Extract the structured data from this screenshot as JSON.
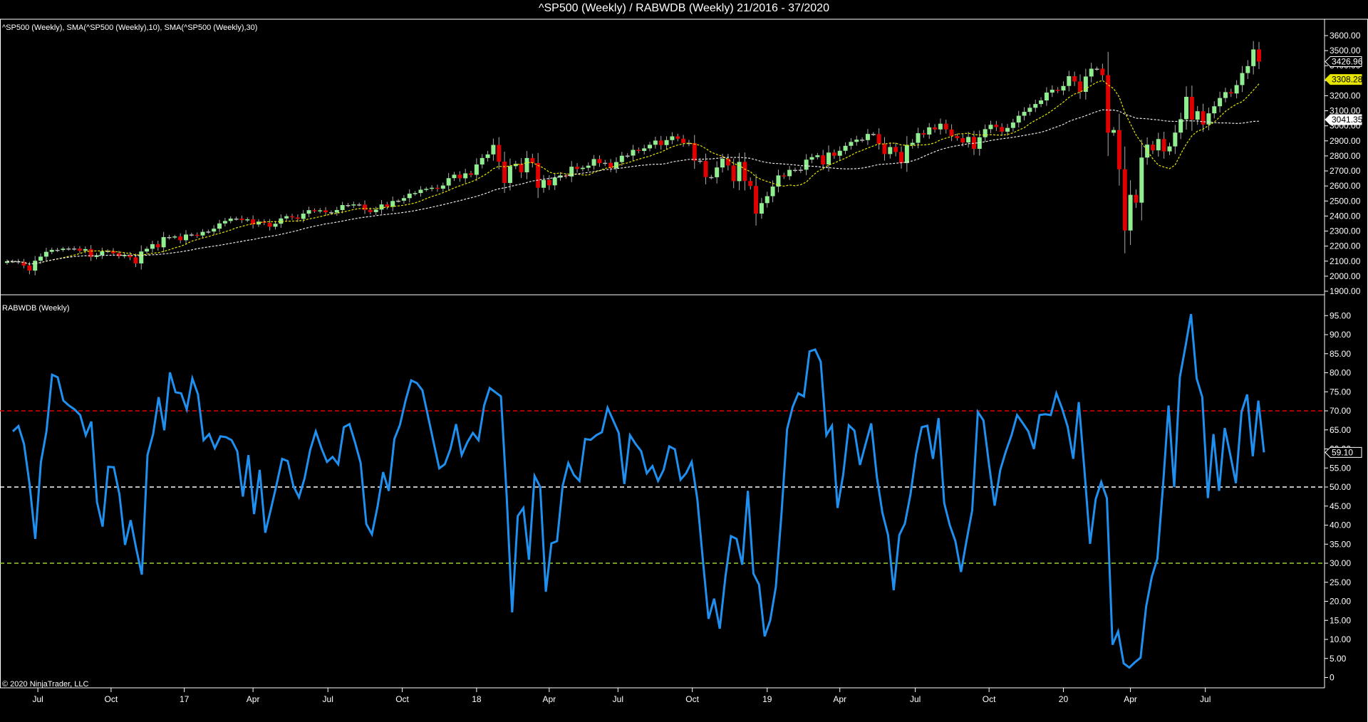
{
  "header": {
    "title": "^SP500 (Weekly) / RABWDB (Weekly)  21/2016 - 37/2020"
  },
  "price_panel": {
    "legend": "^SP500 (Weekly), SMA(^SP500 (Weekly),10), SMA(^SP500 (Weekly),30)"
  },
  "indicator_panel": {
    "legend": "RABWDB (Weekly)"
  },
  "footer": {
    "copyright": "© 2020 NinjaTrader, LLC"
  },
  "colors": {
    "up": "#90ee90",
    "down": "#e00000",
    "sma10": "#e6e600",
    "sma30": "#e8e8e8",
    "indicator": "#2090f0",
    "overbought": "#e00000",
    "mid": "#ffffff",
    "oversold": "#9acd32"
  },
  "chart_data": [
    {
      "type": "candlestick",
      "title": "^SP500 (Weekly)",
      "ylim": [
        1900,
        3600
      ],
      "yticks": [
        "1900.00",
        "2000.00",
        "2100.00",
        "2200.00",
        "2300.00",
        "2400.00",
        "2500.00",
        "2600.00",
        "2700.00",
        "2800.00",
        "2900.00",
        "3000.00",
        "3100.00",
        "3200.00",
        "3300.00",
        "3400.00",
        "3500.00",
        "3600.00"
      ],
      "yticks_values": [
        1900,
        2000,
        2100,
        2200,
        2300,
        2400,
        2500,
        2600,
        2700,
        2800,
        2900,
        3000,
        3100,
        3200,
        3300,
        3400,
        3500,
        3600
      ],
      "closes": [
        2099,
        2099,
        2096,
        2071,
        2037,
        2103,
        2130,
        2162,
        2175,
        2174,
        2183,
        2184,
        2184,
        2169,
        2180,
        2128,
        2139,
        2165,
        2168,
        2153,
        2133,
        2141,
        2126,
        2085,
        2164,
        2182,
        2213,
        2192,
        2260,
        2258,
        2264,
        2239,
        2277,
        2275,
        2271,
        2295,
        2297,
        2316,
        2351,
        2367,
        2383,
        2383,
        2373,
        2378,
        2344,
        2363,
        2355,
        2329,
        2349,
        2384,
        2399,
        2391,
        2381,
        2416,
        2439,
        2433,
        2438,
        2425,
        2423,
        2440,
        2473,
        2472,
        2477,
        2476,
        2441,
        2426,
        2443,
        2477,
        2461,
        2500,
        2502,
        2519,
        2549,
        2553,
        2575,
        2581,
        2588,
        2582,
        2603,
        2652,
        2675,
        2651,
        2684,
        2674,
        2743,
        2786,
        2810,
        2873,
        2762,
        2620,
        2732,
        2747,
        2691,
        2786,
        2752,
        2588,
        2640,
        2604,
        2656,
        2670,
        2663,
        2728,
        2713,
        2721,
        2735,
        2779,
        2752,
        2754,
        2718,
        2759,
        2801,
        2802,
        2840,
        2833,
        2850,
        2874,
        2902,
        2872,
        2905,
        2930,
        2914,
        2886,
        2885,
        2768,
        2767,
        2659,
        2658,
        2723,
        2781,
        2736,
        2632,
        2760,
        2633,
        2600,
        2416,
        2486,
        2532,
        2596,
        2670,
        2665,
        2707,
        2706,
        2708,
        2775,
        2792,
        2804,
        2743,
        2822,
        2801,
        2834,
        2867,
        2893,
        2908,
        2905,
        2946,
        2945,
        2881,
        2812,
        2859,
        2826,
        2752,
        2873,
        2887,
        2951,
        2942,
        2990,
        2976,
        3014,
        2976,
        2932,
        2918,
        2889,
        2926,
        2847,
        2924,
        2978,
        3007,
        2992,
        2961,
        2986,
        3022,
        3067,
        3093,
        3120,
        3145,
        3169,
        3221,
        3240,
        3235,
        3265,
        3330,
        3295,
        3226,
        3328,
        3380,
        3380,
        3337,
        2954,
        2972,
        2711,
        2304,
        2541,
        2489,
        2789,
        2875,
        2837,
        2912,
        2830,
        2863,
        2955,
        3044,
        3193,
        3041,
        3097,
        3009,
        3083,
        3130,
        3185,
        3224,
        3215,
        3271,
        3351,
        3397,
        3508,
        3426.96
      ],
      "series": [
        {
          "name": "SMA 10",
          "period": 10
        },
        {
          "name": "SMA 30",
          "period": 30
        }
      ],
      "price_markers": [
        {
          "label": "3426.96",
          "value": 3426.96,
          "style": "last"
        },
        {
          "label": "3308.28",
          "value": 3308.28,
          "style": "sma10"
        },
        {
          "label": "3041.35",
          "value": 3041.35,
          "style": "sma30"
        }
      ]
    },
    {
      "type": "line",
      "title": "RABWDB (Weekly)",
      "ylim": [
        0,
        95
      ],
      "yticks": [
        "0",
        "5.00",
        "10.00",
        "15.00",
        "20.00",
        "25.00",
        "30.00",
        "35.00",
        "40.00",
        "45.00",
        "50.00",
        "55.00",
        "60.00",
        "65.00",
        "70.00",
        "75.00",
        "80.00",
        "85.00",
        "90.00",
        "95.00"
      ],
      "yticks_values": [
        0,
        5,
        10,
        15,
        20,
        25,
        30,
        35,
        40,
        45,
        50,
        55,
        60,
        65,
        70,
        75,
        80,
        85,
        90,
        95
      ],
      "levels": [
        {
          "name": "overbought",
          "value": 70
        },
        {
          "name": "mid",
          "value": 50
        },
        {
          "name": "oversold",
          "value": 30
        }
      ],
      "values": [
        64.6,
        66,
        61.3,
        50.6,
        36.4,
        56.5,
        64.6,
        79.5,
        78.8,
        72.7,
        71.4,
        70.4,
        68.9,
        63.6,
        67.2,
        46.1,
        39.6,
        55.3,
        55.2,
        48.1,
        34.8,
        41.3,
        33.8,
        27,
        58.4,
        63.9,
        73.6,
        64.9,
        80.1,
        74.9,
        74.6,
        70.4,
        78.5,
        74.3,
        62.3,
        63.9,
        60.2,
        63.3,
        63.1,
        62.3,
        59.4,
        47.5,
        58.4,
        42.9,
        54.5,
        38,
        44.2,
        50.6,
        57.4,
        56.8,
        50.3,
        47.3,
        52.3,
        59.7,
        64.6,
        60.2,
        56.6,
        57.9,
        56,
        65.7,
        66.5,
        61.7,
        56.3,
        40.3,
        37.6,
        44.8,
        53.9,
        49,
        62.6,
        66.3,
        72.7,
        78,
        77.3,
        75.4,
        68.6,
        61.7,
        54.9,
        56,
        60,
        66.5,
        58.4,
        61.7,
        64.2,
        62.3,
        71.4,
        76,
        74.9,
        73.8,
        48.1,
        17.1,
        42.4,
        44.5,
        30.9,
        52.9,
        50,
        22.5,
        35.2,
        35.8,
        50.3,
        56.3,
        53.2,
        51.6,
        62.6,
        62.4,
        63.6,
        64.4,
        70.8,
        67.5,
        64.2,
        50.8,
        63.6,
        61.3,
        59.4,
        53.6,
        55.5,
        51.6,
        54.5,
        60.7,
        59.9,
        51.9,
        53.6,
        56.6,
        46.8,
        30.6,
        15.4,
        20.7,
        12.8,
        26.4,
        37.1,
        36.4,
        29.6,
        49,
        27.3,
        24.4,
        10.8,
        15,
        23.8,
        42.9,
        65.2,
        71,
        74.6,
        73.8,
        85.6,
        86.1,
        82.9,
        63.6,
        66.1,
        44.5,
        53.2,
        66.2,
        64.8,
        55.8,
        61.3,
        66.7,
        52.6,
        43.2,
        37.4,
        22.9,
        37.4,
        40.4,
        48.1,
        58.7,
        65.7,
        66.1,
        57.4,
        68.1,
        45.8,
        40,
        35.8,
        27.7,
        36.1,
        43.9,
        69.7,
        67.5,
        55.8,
        45.1,
        54.5,
        59.4,
        63.6,
        68.9,
        66.8,
        64.6,
        60,
        68.9,
        69.1,
        68.9,
        74.6,
        70.7,
        65.9,
        57.4,
        72.3,
        54.5,
        35.1,
        46.8,
        51.3,
        47.1,
        8.6,
        12.1,
        3.7,
        2.6,
        4,
        5.2,
        18.6,
        26.4,
        31.2,
        50.3,
        71.4,
        50,
        78.8,
        86.9,
        95.4,
        78.5,
        73.6,
        47.1,
        63.9,
        49,
        65.5,
        58.4,
        51,
        69.7,
        74.3,
        58.1,
        72.7,
        59.1
      ],
      "last_marker": {
        "label": "59.10",
        "value": 59.1
      }
    }
  ],
  "xaxis": {
    "unit": "week index",
    "ticks": [
      {
        "label": "Jul",
        "week": 5.5
      },
      {
        "label": "Oct",
        "week": 18.6
      },
      {
        "label": "17",
        "week": 31.7
      },
      {
        "label": "Apr",
        "week": 44
      },
      {
        "label": "Jul",
        "week": 57.4
      },
      {
        "label": "Oct",
        "week": 70.7
      },
      {
        "label": "18",
        "week": 84
      },
      {
        "label": "Apr",
        "week": 97
      },
      {
        "label": "Jul",
        "week": 109.3
      },
      {
        "label": "Oct",
        "week": 122.6
      },
      {
        "label": "19",
        "week": 136
      },
      {
        "label": "Apr",
        "week": 149
      },
      {
        "label": "Jul",
        "week": 162.5
      },
      {
        "label": "Oct",
        "week": 175.7
      },
      {
        "label": "20",
        "week": 189
      },
      {
        "label": "Apr",
        "week": 201
      },
      {
        "label": "Jul",
        "week": 214.4
      }
    ]
  }
}
